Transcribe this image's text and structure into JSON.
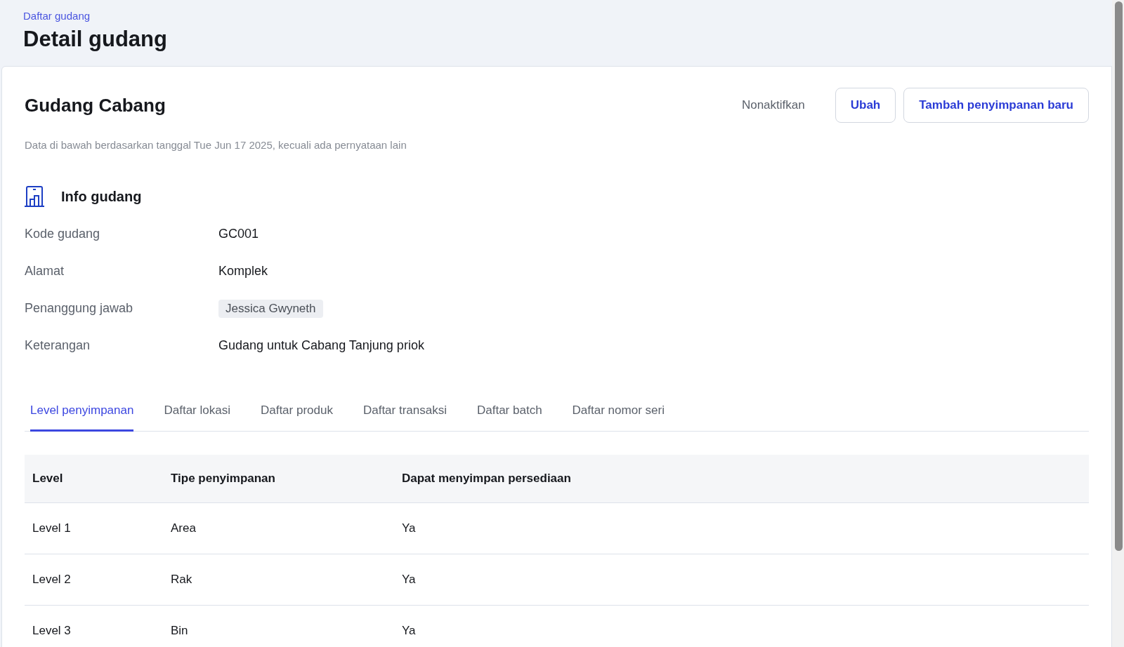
{
  "breadcrumb": "Daftar gudang",
  "page_title": "Detail gudang",
  "warehouse": {
    "name": "Gudang Cabang",
    "note": "Data di bawah berdasarkan tanggal Tue Jun 17 2025, kecuali ada pernyataan lain"
  },
  "actions": [
    {
      "label": "Nonaktifkan",
      "kind": "text"
    },
    {
      "label": "Ubah",
      "kind": "outline"
    },
    {
      "label": "Tambah penyimpanan baru",
      "kind": "outline"
    }
  ],
  "info": {
    "title": "Info gudang",
    "fields": [
      {
        "label": "Kode gudang",
        "value": "GC001",
        "kind": "text"
      },
      {
        "label": "Alamat",
        "value": "Komplek",
        "kind": "text"
      },
      {
        "label": "Penanggung jawab",
        "value": "Jessica Gwyneth",
        "kind": "tag"
      },
      {
        "label": "Keterangan",
        "value": "Gudang untuk Cabang Tanjung priok",
        "kind": "text"
      }
    ]
  },
  "tabs": [
    {
      "label": "Level penyimpanan",
      "selected": true
    },
    {
      "label": "Daftar lokasi",
      "selected": false
    },
    {
      "label": "Daftar produk",
      "selected": false
    },
    {
      "label": "Daftar transaksi",
      "selected": false
    },
    {
      "label": "Daftar batch",
      "selected": false
    },
    {
      "label": "Daftar nomor seri",
      "selected": false
    }
  ],
  "table": {
    "columns": [
      "Level",
      "Tipe penyimpanan",
      "Dapat menyimpan persediaan"
    ],
    "rows": [
      [
        "Level 1",
        "Area",
        "Ya"
      ],
      [
        "Level 2",
        "Rak",
        "Ya"
      ],
      [
        "Level 3",
        "Bin",
        "Ya"
      ]
    ]
  }
}
